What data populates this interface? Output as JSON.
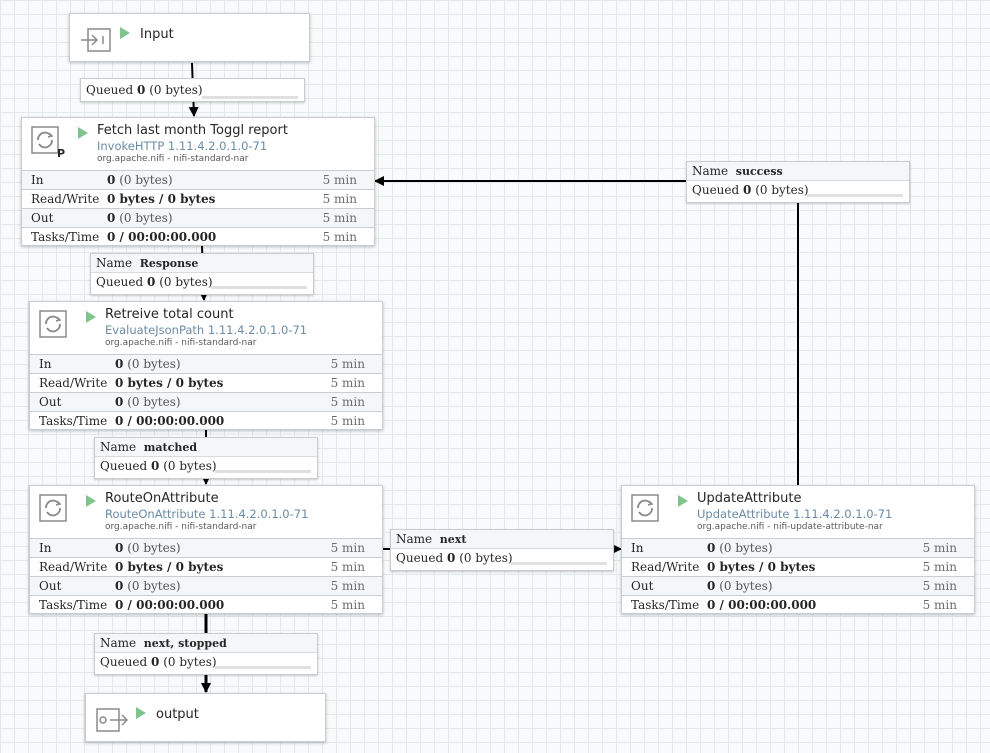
{
  "ports": {
    "input": {
      "name": "Input"
    },
    "output": {
      "name": "output"
    }
  },
  "processors": {
    "fetch": {
      "title": "Fetch last month Toggl report",
      "type": "InvokeHTTP 1.11.4.2.0.1.0-71",
      "bundle": "org.apache.nifi - nifi-standard-nar",
      "badge": "P",
      "stats": [
        {
          "label": "In",
          "count": "0",
          "bytes": "(0 bytes)",
          "time": "5 min"
        },
        {
          "label": "Read/Write",
          "count": "0 bytes / 0 bytes",
          "bytes": "",
          "time": "5 min"
        },
        {
          "label": "Out",
          "count": "0",
          "bytes": "(0 bytes)",
          "time": "5 min"
        },
        {
          "label": "Tasks/Time",
          "count": "0 / 00:00:00.000",
          "bytes": "",
          "time": "5 min"
        }
      ]
    },
    "retrieve": {
      "title": "Retreive total count",
      "type": "EvaluateJsonPath 1.11.4.2.0.1.0-71",
      "bundle": "org.apache.nifi - nifi-standard-nar",
      "stats": [
        {
          "label": "In",
          "count": "0",
          "bytes": "(0 bytes)",
          "time": "5 min"
        },
        {
          "label": "Read/Write",
          "count": "0 bytes / 0 bytes",
          "bytes": "",
          "time": "5 min"
        },
        {
          "label": "Out",
          "count": "0",
          "bytes": "(0 bytes)",
          "time": "5 min"
        },
        {
          "label": "Tasks/Time",
          "count": "0 / 00:00:00.000",
          "bytes": "",
          "time": "5 min"
        }
      ]
    },
    "route": {
      "title": "RouteOnAttribute",
      "type": "RouteOnAttribute 1.11.4.2.0.1.0-71",
      "bundle": "org.apache.nifi - nifi-standard-nar",
      "stats": [
        {
          "label": "In",
          "count": "0",
          "bytes": "(0 bytes)",
          "time": "5 min"
        },
        {
          "label": "Read/Write",
          "count": "0 bytes / 0 bytes",
          "bytes": "",
          "time": "5 min"
        },
        {
          "label": "Out",
          "count": "0",
          "bytes": "(0 bytes)",
          "time": "5 min"
        },
        {
          "label": "Tasks/Time",
          "count": "0 / 00:00:00.000",
          "bytes": "",
          "time": "5 min"
        }
      ]
    },
    "update": {
      "title": "UpdateAttribute",
      "type": "UpdateAttribute 1.11.4.2.0.1.0-71",
      "bundle": "org.apache.nifi - nifi-update-attribute-nar",
      "stats": [
        {
          "label": "In",
          "count": "0",
          "bytes": "(0 bytes)",
          "time": "5 min"
        },
        {
          "label": "Read/Write",
          "count": "0 bytes / 0 bytes",
          "bytes": "",
          "time": "5 min"
        },
        {
          "label": "Out",
          "count": "0",
          "bytes": "(0 bytes)",
          "time": "5 min"
        },
        {
          "label": "Tasks/Time",
          "count": "0 / 00:00:00.000",
          "bytes": "",
          "time": "5 min"
        }
      ]
    }
  },
  "connections": {
    "name_label": "Name",
    "queued_label": "Queued",
    "input_fetch": {
      "name": "",
      "count": "0",
      "bytes": "(0 bytes)"
    },
    "success": {
      "name": "success",
      "count": "0",
      "bytes": "(0 bytes)"
    },
    "response": {
      "name": "Response",
      "count": "0",
      "bytes": "(0 bytes)"
    },
    "matched": {
      "name": "matched",
      "count": "0",
      "bytes": "(0 bytes)"
    },
    "next": {
      "name": "next",
      "count": "0",
      "bytes": "(0 bytes)"
    },
    "next_stopped": {
      "name": "next, stopped",
      "count": "0",
      "bytes": "(0 bytes)"
    }
  },
  "colors": {
    "running": "#7fc48c",
    "type_text": "#6a8ba5"
  },
  "icons": {
    "processor": "processor-icon",
    "input_port": "input-port-icon",
    "output_port": "output-port-icon"
  }
}
